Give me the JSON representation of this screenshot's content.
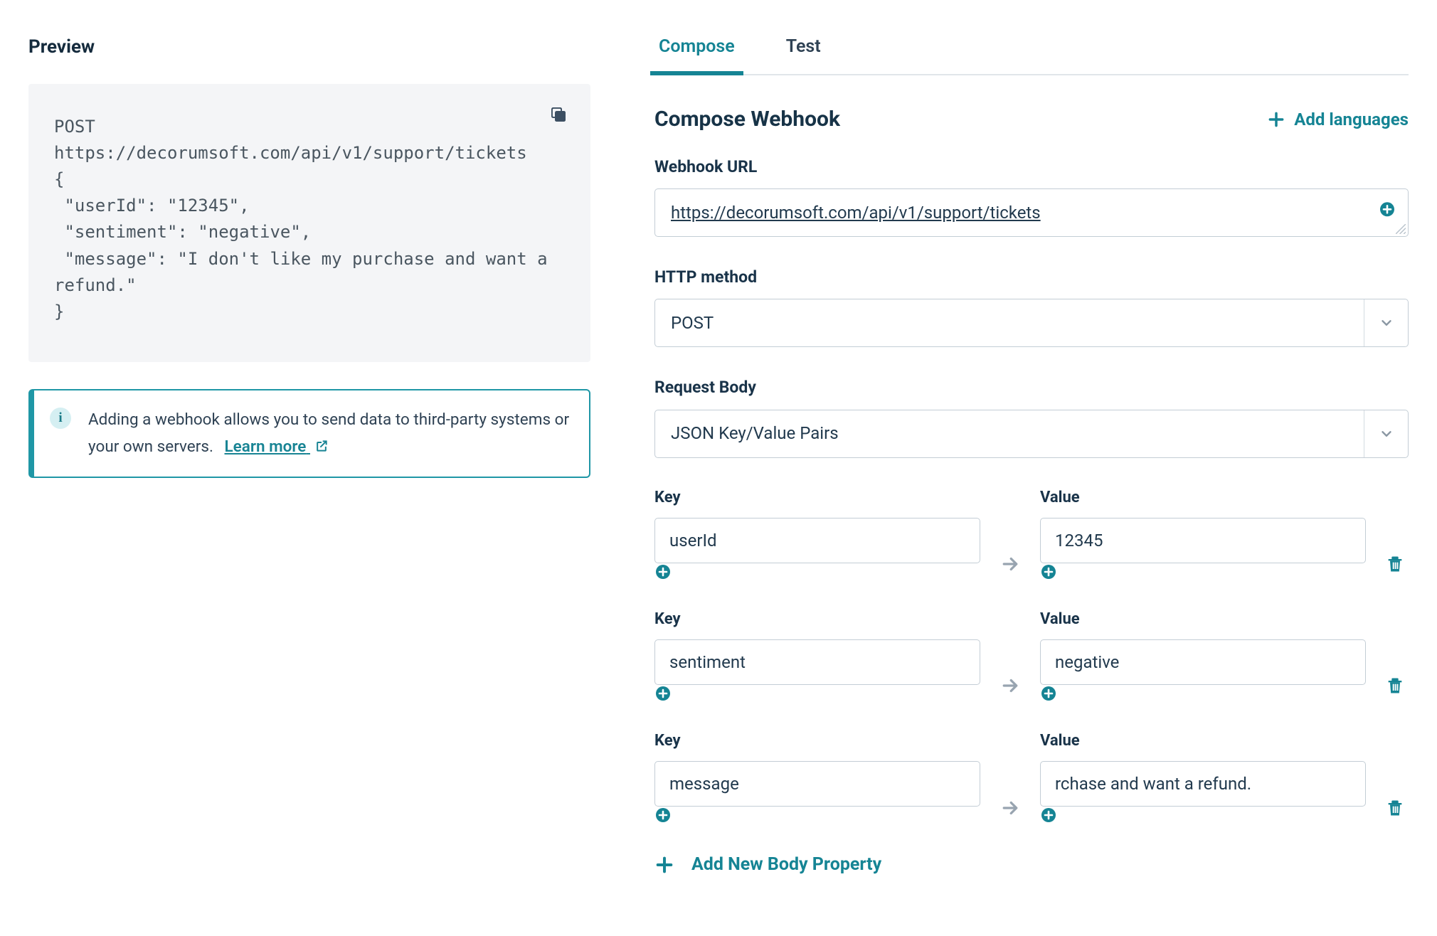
{
  "left": {
    "heading": "Preview",
    "code": "POST\nhttps://decorumsoft.com/api/v1/support/tickets\n{\n \"userId\": \"12345\",\n \"sentiment\": \"negative\",\n \"message\": \"I don't like my purchase and want a refund.\"\n}",
    "info_text": "Adding a webhook allows you to send data to third-party systems or your own servers.",
    "learn_more": "Learn more"
  },
  "tabs": {
    "compose": "Compose",
    "test": "Test"
  },
  "form": {
    "title": "Compose Webhook",
    "add_languages": "Add languages",
    "webhook_url_label": "Webhook URL",
    "webhook_url_value": "https://decorumsoft.com/api/v1/support/tickets",
    "http_method_label": "HTTP method",
    "http_method_value": "POST",
    "request_body_label": "Request Body",
    "request_body_value": "JSON Key/Value Pairs",
    "key_label": "Key",
    "value_label": "Value",
    "rows": [
      {
        "key": "userId",
        "value": "12345"
      },
      {
        "key": "sentiment",
        "value": "negative"
      },
      {
        "key": "message",
        "value": "rchase and want a refund."
      }
    ],
    "add_body_property": "Add New Body Property"
  },
  "colors": {
    "accent": "#158494"
  }
}
